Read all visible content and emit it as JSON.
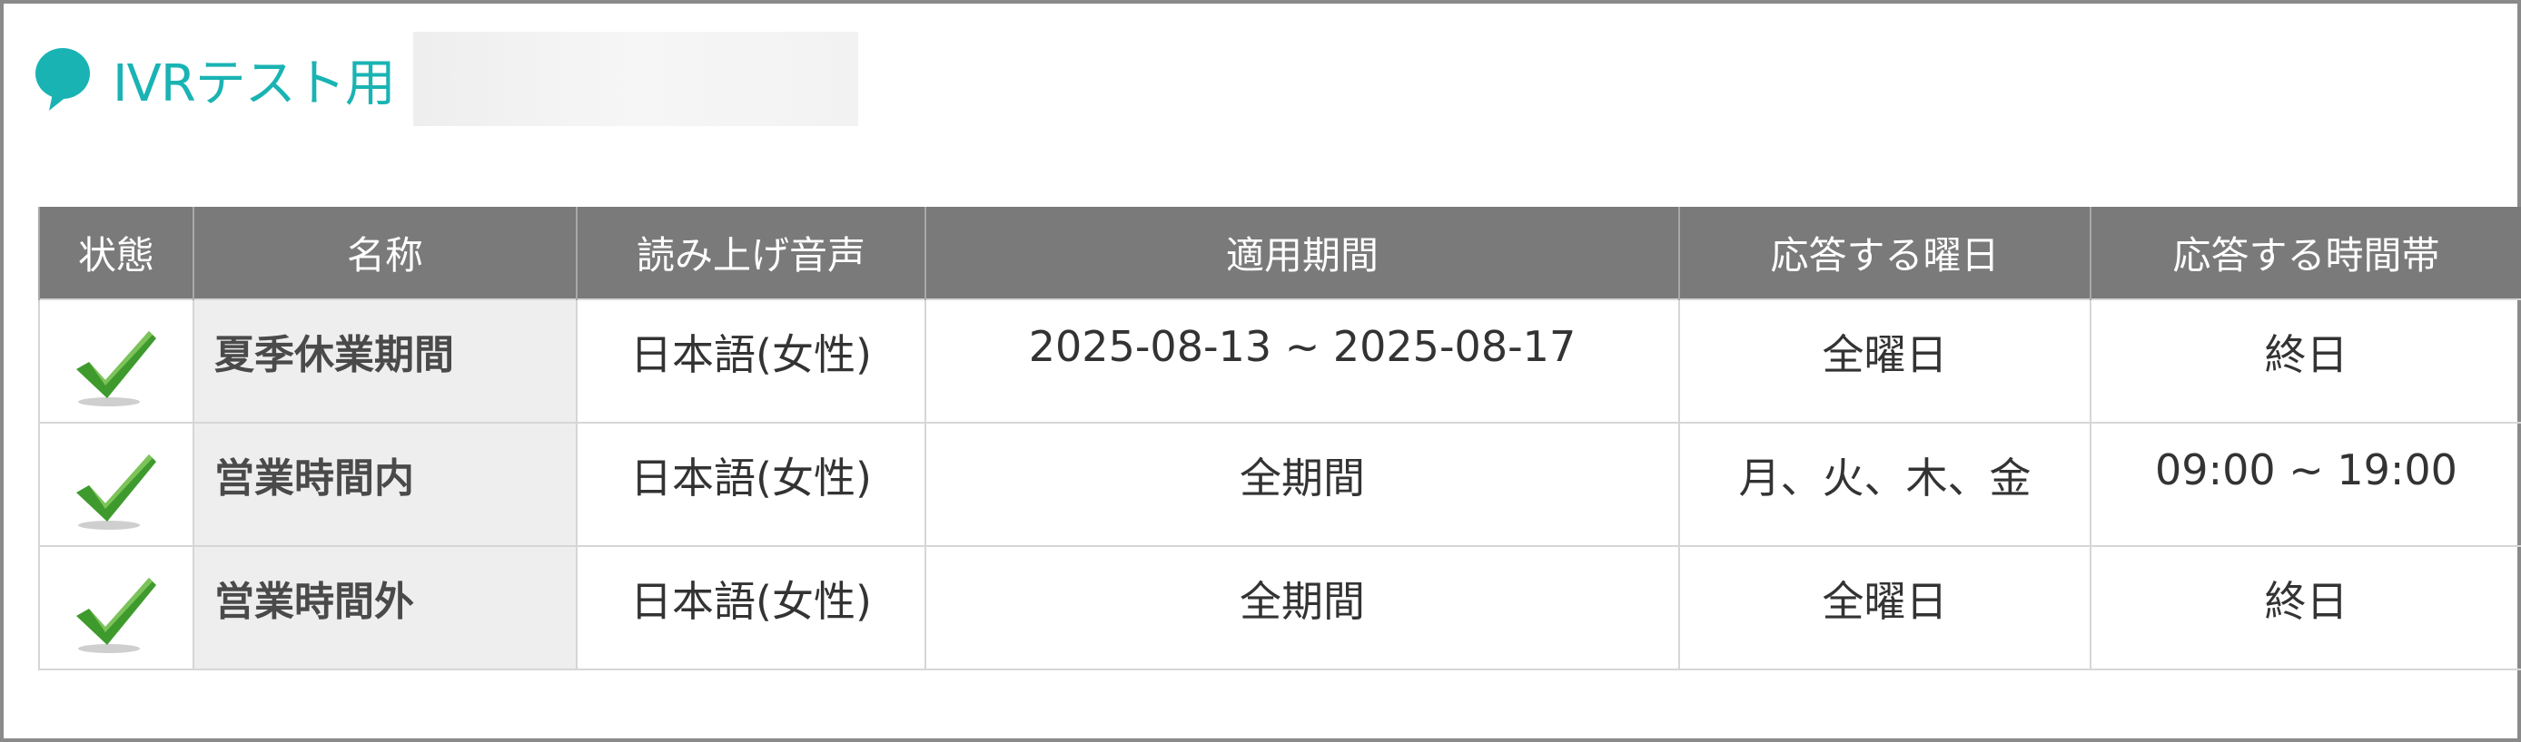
{
  "header": {
    "title": "IVRテスト用",
    "icon": "speech-bubble-icon",
    "accent_color": "#1ab3b3"
  },
  "table": {
    "columns": [
      "状態",
      "名称",
      "読み上げ音声",
      "適用期間",
      "応答する曜日",
      "応答する時間帯"
    ],
    "rows": [
      {
        "status_icon": "check-icon",
        "name": "夏季休業期間",
        "voice": "日本語(女性)",
        "period": "2025-08-13 ~ 2025-08-17",
        "days": "全曜日",
        "hours": "終日"
      },
      {
        "status_icon": "check-icon",
        "name": "営業時間内",
        "voice": "日本語(女性)",
        "period": "全期間",
        "days": "月、火、木、金",
        "hours": "09:00 ~ 19:00"
      },
      {
        "status_icon": "check-icon",
        "name": "営業時間外",
        "voice": "日本語(女性)",
        "period": "全期間",
        "days": "全曜日",
        "hours": "終日"
      }
    ]
  },
  "colors": {
    "header_bg": "#7a7a7a",
    "name_cell_bg": "#eeeeee",
    "check_green": "#3f9a2e"
  }
}
